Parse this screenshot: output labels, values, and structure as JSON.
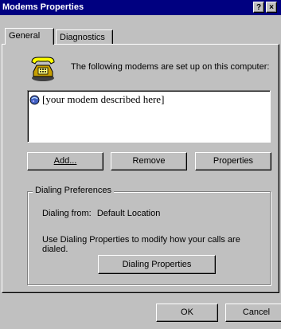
{
  "window": {
    "title": "Modems Properties",
    "help_glyph": "?",
    "close_glyph": "×"
  },
  "tabs": [
    {
      "label": "General",
      "active": true
    },
    {
      "label": "Diagnostics",
      "active": false
    }
  ],
  "general": {
    "intro_text": "The following modems are set up on this computer:",
    "modem_list": [
      "[your modem described here]"
    ],
    "buttons": {
      "add": {
        "label": "Add...",
        "mnemonic": "A"
      },
      "remove": {
        "label": "Remove",
        "mnemonic": "e"
      },
      "properties": {
        "label": "Properties",
        "mnemonic": "r"
      }
    },
    "dialing_preferences": {
      "legend": "Dialing Preferences",
      "dialing_from_label": "Dialing from:",
      "dialing_from_value": "Default Location",
      "help_text": "Use Dialing Properties to modify how your calls are dialed.",
      "dialing_properties_button": "Dialing Properties"
    }
  },
  "footer": {
    "ok": "OK",
    "cancel": "Cancel"
  }
}
